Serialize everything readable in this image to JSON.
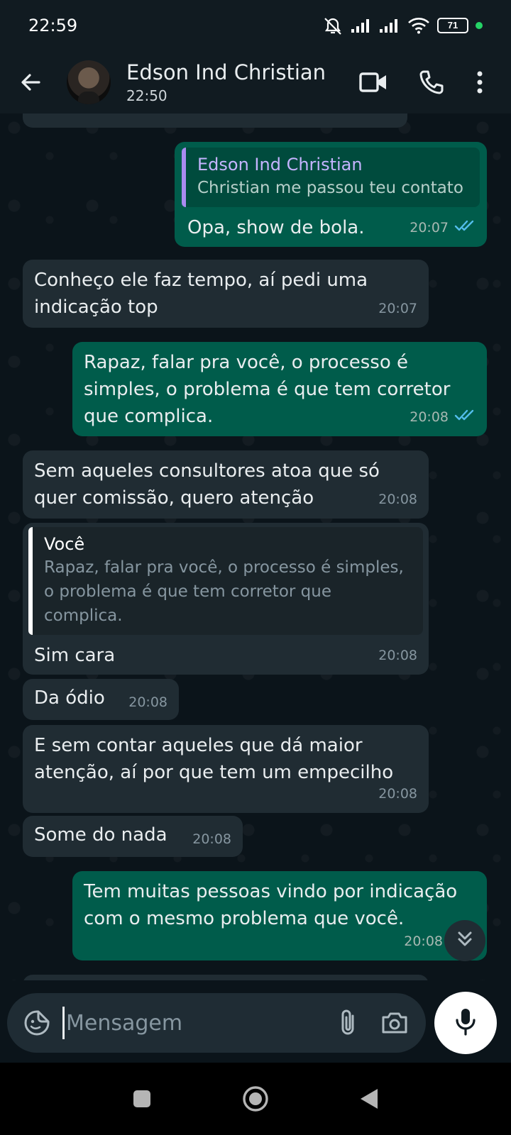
{
  "status_bar": {
    "time": "22:59",
    "battery": "71",
    "icons": [
      "mute-icon",
      "signal-icon",
      "signal-icon",
      "wifi-icon",
      "battery-icon"
    ]
  },
  "header": {
    "contact_name": "Edson Ind Christian",
    "contact_status": "22:50",
    "icons": [
      "back-arrow-icon",
      "video-call-icon",
      "phone-icon",
      "more-options-icon"
    ]
  },
  "messages": [
    {
      "direction": "out",
      "quote": {
        "author": "Edson Ind Christian",
        "text": "Christian me passou teu contato"
      },
      "text": "Opa, show de bola.",
      "time": "20:07",
      "read": true
    },
    {
      "direction": "in",
      "text": "Conheço ele faz tempo, aí pedi uma indicação top",
      "time": "20:07"
    },
    {
      "direction": "out",
      "text": "Rapaz, falar pra você, o processo é simples, o problema é que tem corretor que complica.",
      "time": "20:08",
      "read": true
    },
    {
      "direction": "in",
      "text": "Sem aqueles consultores atoa que só quer comissão, quero atenção",
      "time": "20:08"
    },
    {
      "direction": "in",
      "quote": {
        "author": "Você",
        "text": "Rapaz, falar pra você, o processo é simples, o problema é que tem corretor que complica."
      },
      "text": "Sim cara",
      "time": "20:08"
    },
    {
      "direction": "in",
      "text": "Da ódio",
      "time": "20:08"
    },
    {
      "direction": "in",
      "text": "E sem contar aqueles que dá maior atenção, aí por que tem um empecilho",
      "time": "20:08"
    },
    {
      "direction": "in",
      "text": "Some do nada",
      "time": "20:08"
    },
    {
      "direction": "out",
      "text": "Tem muitas pessoas vindo por indicação com o mesmo problema que você.",
      "time": "20:08"
    }
  ],
  "input": {
    "placeholder": "Mensagem",
    "icons": [
      "sticker-icon",
      "attach-icon",
      "camera-icon",
      "mic-icon"
    ]
  },
  "colors": {
    "background": "#0b141a",
    "bar": "#111b21",
    "incoming_bubble": "#202c33",
    "outgoing_bubble": "#005c4b",
    "read_ticks": "#53bdeb",
    "accent_green": "#25d366"
  }
}
